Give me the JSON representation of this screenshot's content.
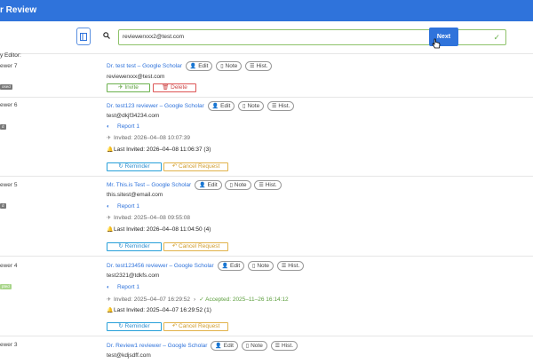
{
  "header": {
    "title": "r Review"
  },
  "search": {
    "value": "reviewerxxx2@test.com",
    "next_label": "Next"
  },
  "section_label": "y Editor:",
  "actions": {
    "edit": "Edit",
    "note": "Note",
    "hist": "Hist.",
    "invite": "Invite",
    "delete": "Delete",
    "reminder": "Reminder",
    "cancel": "Cancel Request"
  },
  "reviewers": [
    {
      "label": "ewer 7",
      "badge": "osed",
      "name": "Dr. test test – Google Scholar",
      "email": "reviewerxxx@test.com"
    },
    {
      "label": "ewer 6",
      "badge": "d",
      "name": "Dr. test123 reviewer – Google Scholar",
      "email": "test@dkjf34234.com",
      "report": "Report 1",
      "invited": "Invited: 2026–04–08 10:07:39",
      "last_invited": "Last Invited: 2026–04–08 11:06:37 (3)"
    },
    {
      "label": "ewer 5",
      "badge": "d",
      "name": "Mr. This.is Test – Google Scholar",
      "email": "this.sitest@email.com",
      "report": "Report 1",
      "invited": "Invited: 2025–04–08 09:55:08",
      "last_invited": "Last Invited: 2026–04–08 11:04:50 (4)"
    },
    {
      "label": "ewer 4",
      "badge": "pted",
      "name": "Dr. test123456 reviewer – Google Scholar",
      "email": "test2321@tdkfs.com",
      "report": "Report 1",
      "invited": "Invited: 2025–04–07 16:29:52",
      "accepted": "Accepted: 2025–11–26 16:14:12",
      "last_invited": "Last Invited: 2025–04–07 16:29:52 (1)"
    },
    {
      "label": "ewer 3",
      "name": "Dr. Review1 reviewer – Google Scholar",
      "email": "test@kdjsdff.com"
    }
  ]
}
